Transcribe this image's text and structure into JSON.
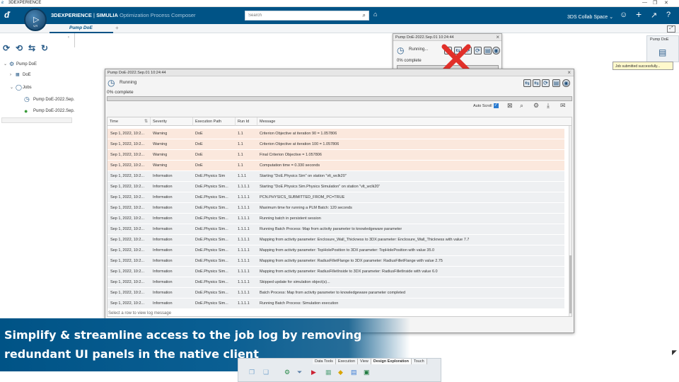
{
  "window": {
    "title": "3DEXPERIENCE",
    "controls": [
      "—",
      "❐",
      "✕"
    ]
  },
  "header": {
    "brand_bold": "3DEXPERIENCE",
    "brand_sep": " | ",
    "brand_company": "SIMULIA",
    "brand_app": "Optimization Process Composer",
    "compass_version": "V,R",
    "search_placeholder": "Search",
    "collab_space": "3DS Collab Space",
    "accent": "#005386"
  },
  "tabs": [
    {
      "label": "Pump DoE"
    }
  ],
  "tree": {
    "root": "Pump DoE",
    "items": [
      "DoE",
      "Jobs"
    ],
    "jobs": [
      "Pump DoE-2022.Sep.",
      "Pump DoE-2022.Sep."
    ]
  },
  "progress_dialog": {
    "title": "Pump DoE-2022.Sep.01 10:24:44",
    "status": "Running...",
    "percent_text": "0% complete",
    "progress": 0
  },
  "mini_panel": {
    "label": "Pump DoE"
  },
  "tooltip": "Job submitted successfully...",
  "log_dialog": {
    "title": "Pump DoE-2022.Sep.01 10:24:44",
    "status": "Running",
    "percent_text": "0% complete",
    "progress": 0,
    "auto_scroll_label": "Auto Scroll",
    "columns": [
      "Time",
      "Severity",
      "Execution Path",
      "Run Id",
      "Message"
    ],
    "rows": [
      {
        "time": "Sep 1, 2022, 10:2...",
        "severity": "Warning",
        "path": "DoE",
        "run": "1.1",
        "msg": "Criterion Objective at iteration  90  = 1.057806"
      },
      {
        "time": "Sep 1, 2022, 10:2...",
        "severity": "Warning",
        "path": "DoE",
        "run": "1.1",
        "msg": "Criterion Objective at iteration 100  = 1.057806"
      },
      {
        "time": "Sep 1, 2022, 10:2...",
        "severity": "Warning",
        "path": "DoE",
        "run": "1.1",
        "msg": "Final Criterion Objective            = 1.057806"
      },
      {
        "time": "Sep 1, 2022, 10:2...",
        "severity": "Warning",
        "path": "DoE",
        "run": "1.1",
        "msg": "Computation time                     = 0.330 seconds"
      },
      {
        "time": "Sep 1, 2022, 10:2...",
        "severity": "Information",
        "path": "DoE.Physics Sim",
        "run": "1.1.1",
        "msg": "Starting \"DoE.Physics Sim\" on station \"vlt_wclk20\""
      },
      {
        "time": "Sep 1, 2022, 10:2...",
        "severity": "Information",
        "path": "DoE.Physics Sim...",
        "run": "1.1.1.1",
        "msg": "Starting \"DoE.Physics Sim.Physics Simulation\" on station \"vlt_wclk20\""
      },
      {
        "time": "Sep 1, 2022, 10:2...",
        "severity": "Information",
        "path": "DoE.Physics Sim...",
        "run": "1.1.1.1",
        "msg": "PCN.PHYSICS_SUBMITTED_FROM_PC=TRUE"
      },
      {
        "time": "Sep 1, 2022, 10:2...",
        "severity": "Information",
        "path": "DoE.Physics Sim...",
        "run": "1.1.1.1",
        "msg": "Maximum time for running a PLM Batch: 120 seconds"
      },
      {
        "time": "Sep 1, 2022, 10:2...",
        "severity": "Information",
        "path": "DoE.Physics Sim...",
        "run": "1.1.1.1",
        "msg": "Running batch in persistent session"
      },
      {
        "time": "Sep 1, 2022, 10:2...",
        "severity": "Information",
        "path": "DoE.Physics Sim...",
        "run": "1.1.1.1",
        "msg": "Running Batch Process: Map from activity parameter to knowledgeware parameter"
      },
      {
        "time": "Sep 1, 2022, 10:2...",
        "severity": "Information",
        "path": "DoE.Physics Sim...",
        "run": "1.1.1.1",
        "msg": "Mapping from activity parameter: Enclosure_Wall_Thickness to 3DX parameter: Enclosure_Wall_Thickness with value 7.7"
      },
      {
        "time": "Sep 1, 2022, 10:2...",
        "severity": "Information",
        "path": "DoE.Physics Sim...",
        "run": "1.1.1.1",
        "msg": "Mapping from activity parameter: TopHolePosition to 3DX parameter: TopHolePosition with value 35.0"
      },
      {
        "time": "Sep 1, 2022, 10:2...",
        "severity": "Information",
        "path": "DoE.Physics Sim...",
        "run": "1.1.1.1",
        "msg": "Mapping from activity parameter: RadiusFilletFlange to 3DX parameter: RadiusFilletFlange with value 2.75"
      },
      {
        "time": "Sep 1, 2022, 10:2...",
        "severity": "Information",
        "path": "DoE.Physics Sim...",
        "run": "1.1.1.1",
        "msg": "Mapping from activity parameter: RadiusFilletInside to 3DX parameter: RadiusFilletInside with value 6.0"
      },
      {
        "time": "Sep 1, 2022, 10:2...",
        "severity": "Information",
        "path": "DoE.Physics Sim...",
        "run": "1.1.1.1",
        "msg": "Skipped update for simulation object(s)..."
      },
      {
        "time": "Sep 1, 2022, 10:2...",
        "severity": "Information",
        "path": "DoE.Physics Sim...",
        "run": "1.1.1.1",
        "msg": "Batch Process: Map from activity parameter to knowledgeware parameter completed"
      },
      {
        "time": "Sep 1, 2022, 10:2...",
        "severity": "Information",
        "path": "DoE.Physics Sim...",
        "run": "1.1.1.1",
        "msg": "Running Batch Process: Simulation execution"
      }
    ],
    "footer_hint": "Select a row to view log message",
    "warning_color": "#fbe8dd",
    "info_color": "#eef0f2"
  },
  "banner": {
    "line1": "Simplify & streamline access to the job log by removing",
    "line2": "redundant UI panels in the native client"
  },
  "ribbon": {
    "tabs": [
      "Data Tools",
      "Execution",
      "View",
      "Design Exploration",
      "Touch"
    ],
    "active": "Design Exploration"
  }
}
